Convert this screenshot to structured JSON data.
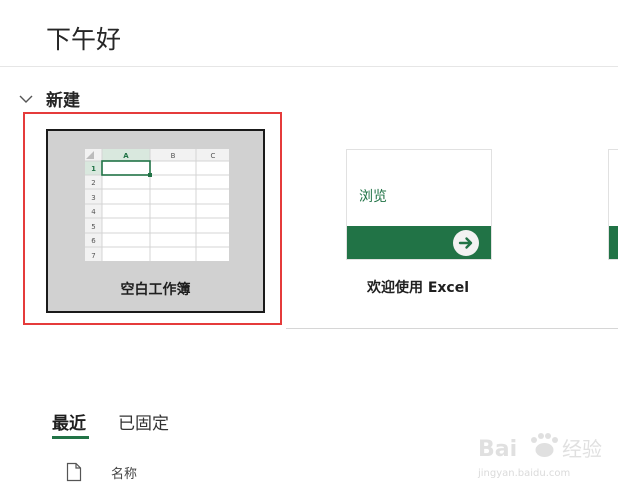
{
  "greeting": "下午好",
  "new_section": {
    "label": "新建",
    "templates": [
      {
        "label": "空白工作簿",
        "preview": {
          "columns": [
            "A",
            "B",
            "C"
          ],
          "rows": [
            "1",
            "2",
            "3",
            "4",
            "5",
            "6",
            "7"
          ]
        }
      },
      {
        "label": "欢迎使用 Excel",
        "card_text": "浏览"
      }
    ]
  },
  "tabs": [
    "最近",
    "已固定"
  ],
  "list_header": {
    "name": "名称"
  },
  "watermark": {
    "text": "Bai 经验",
    "url": "jingyan.baidu.com"
  },
  "colors": {
    "excel_green": "#217346",
    "highlight_red": "#e53b3b",
    "blank_bg": "#d1d1d1"
  }
}
